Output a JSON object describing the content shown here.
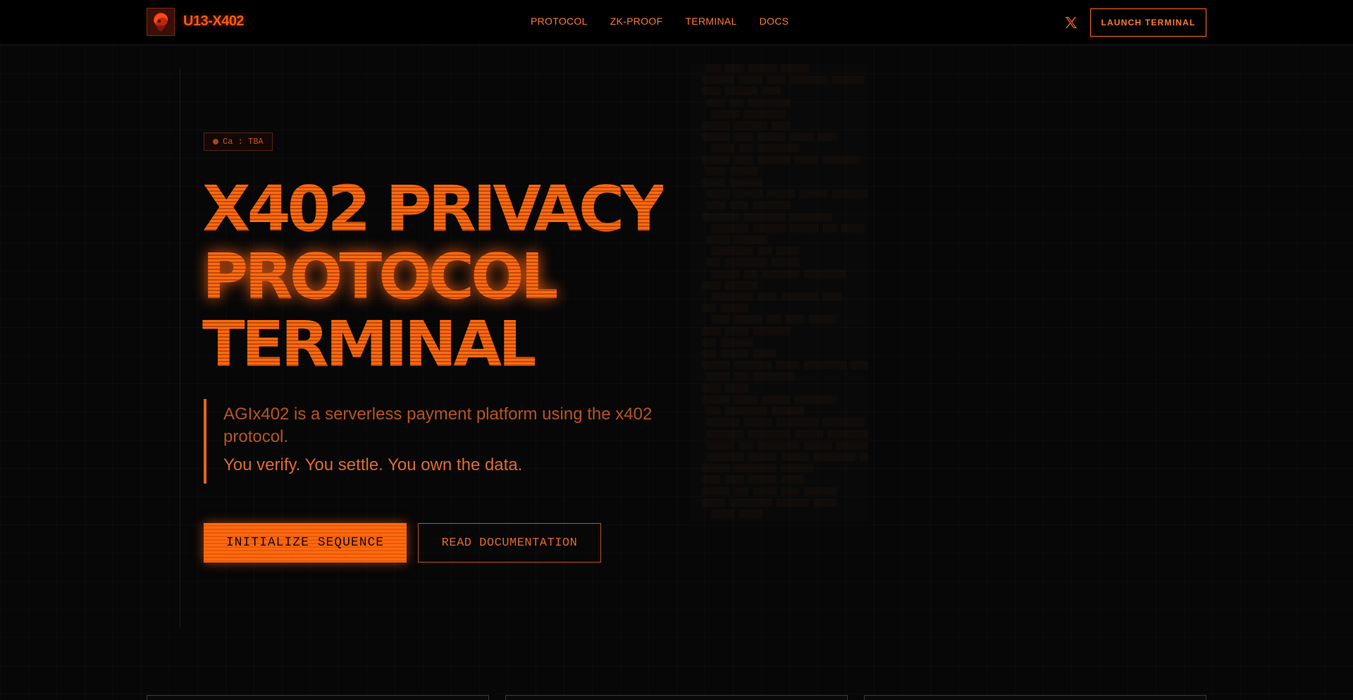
{
  "brand": {
    "name": "U13-X402",
    "logo_icon": "avatar-logo-icon"
  },
  "nav": {
    "items": [
      {
        "label": "PROTOCOL"
      },
      {
        "label": "ZK-PROOF"
      },
      {
        "label": "TERMINAL"
      },
      {
        "label": "DOCS"
      }
    ]
  },
  "header": {
    "social_icon": "x-twitter-icon",
    "launch_label": "LAUNCH TERMINAL"
  },
  "hero": {
    "badge": "Ca : TBA",
    "title_lines": [
      "X402 PRIVACY",
      "PROTOCOL",
      "TERMINAL"
    ],
    "description": "AGIx402 is a serverless payment platform using the x402 protocol.",
    "tagline": "You verify. You settle. You own the data.",
    "primary_button": "INITIALIZE SEQUENCE",
    "secondary_button": "READ DOCUMENTATION"
  },
  "colors": {
    "accent": "#ff6a1a",
    "background": "#070707",
    "muted_accent": "#b5551f"
  }
}
